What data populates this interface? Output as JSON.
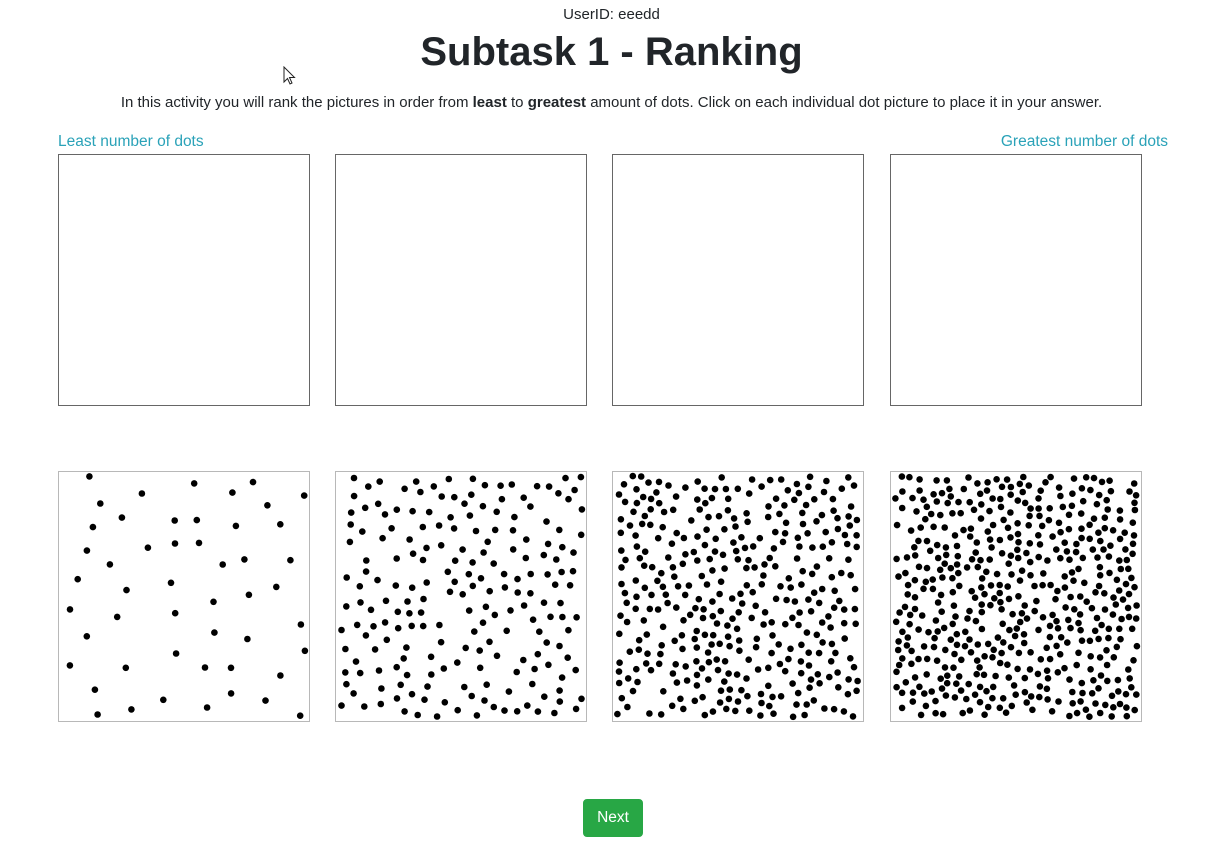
{
  "header": {
    "userid": "UserID: eeedd",
    "title": "Subtask 1 - Ranking"
  },
  "instructions": {
    "part1": "In this activity you will rank the pictures in order from ",
    "least": "least",
    "part2": " to ",
    "greatest": "greatest",
    "part3": " amount of dots. Click on each individual dot picture to place it in your answer."
  },
  "ranking": {
    "left_label": "Least number of dots",
    "right_label": "Greatest number of dots"
  },
  "options": [
    {
      "name": "dot-picture-1",
      "dot_count": 50
    },
    {
      "name": "dot-picture-2",
      "dot_count": 200
    },
    {
      "name": "dot-picture-3",
      "dot_count": 360
    },
    {
      "name": "dot-picture-4",
      "dot_count": 480
    }
  ],
  "actions": {
    "next_label": "Next"
  },
  "colors": {
    "accent": "#2aa2b8",
    "next_button": "#28a745",
    "dot": "#000000"
  }
}
